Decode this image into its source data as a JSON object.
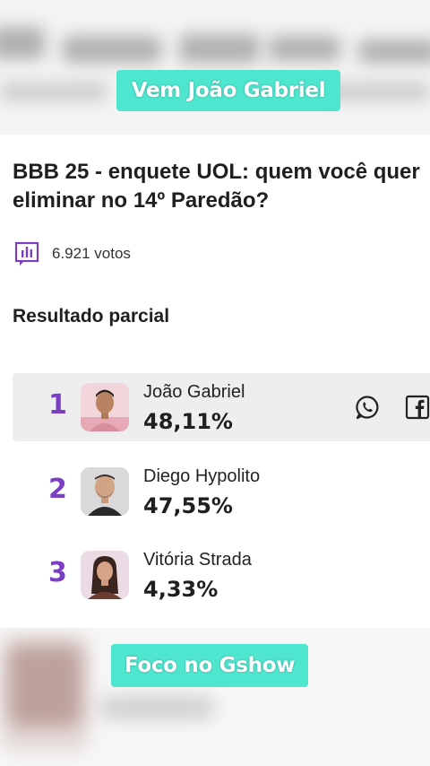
{
  "captions": {
    "top": "Vem João Gabriel",
    "bottom": "Foco no Gshow"
  },
  "poll": {
    "title": "BBB 25 - enquete UOL: quem você quer eliminar no 14º Paredão?",
    "votes": "6.921 votos",
    "results_heading": "Resultado parcial"
  },
  "results": [
    {
      "rank": "1",
      "name": "João Gabriel",
      "percent": "48,11%",
      "share_percent": 48.11
    },
    {
      "rank": "2",
      "name": "Diego Hypolito",
      "percent": "47,55%",
      "share_percent": 47.55
    },
    {
      "rank": "3",
      "name": "Vitória Strada",
      "percent": "4,33%",
      "share_percent": 4.33
    }
  ],
  "colors": {
    "accent_purple": "#7b3fc4",
    "caption_bg": "#4ee6cf",
    "highlight_row": "#eeeef1"
  },
  "icons": {
    "votes": "bar-chart-icon",
    "share_whatsapp": "whatsapp-icon",
    "share_facebook": "facebook-icon"
  }
}
